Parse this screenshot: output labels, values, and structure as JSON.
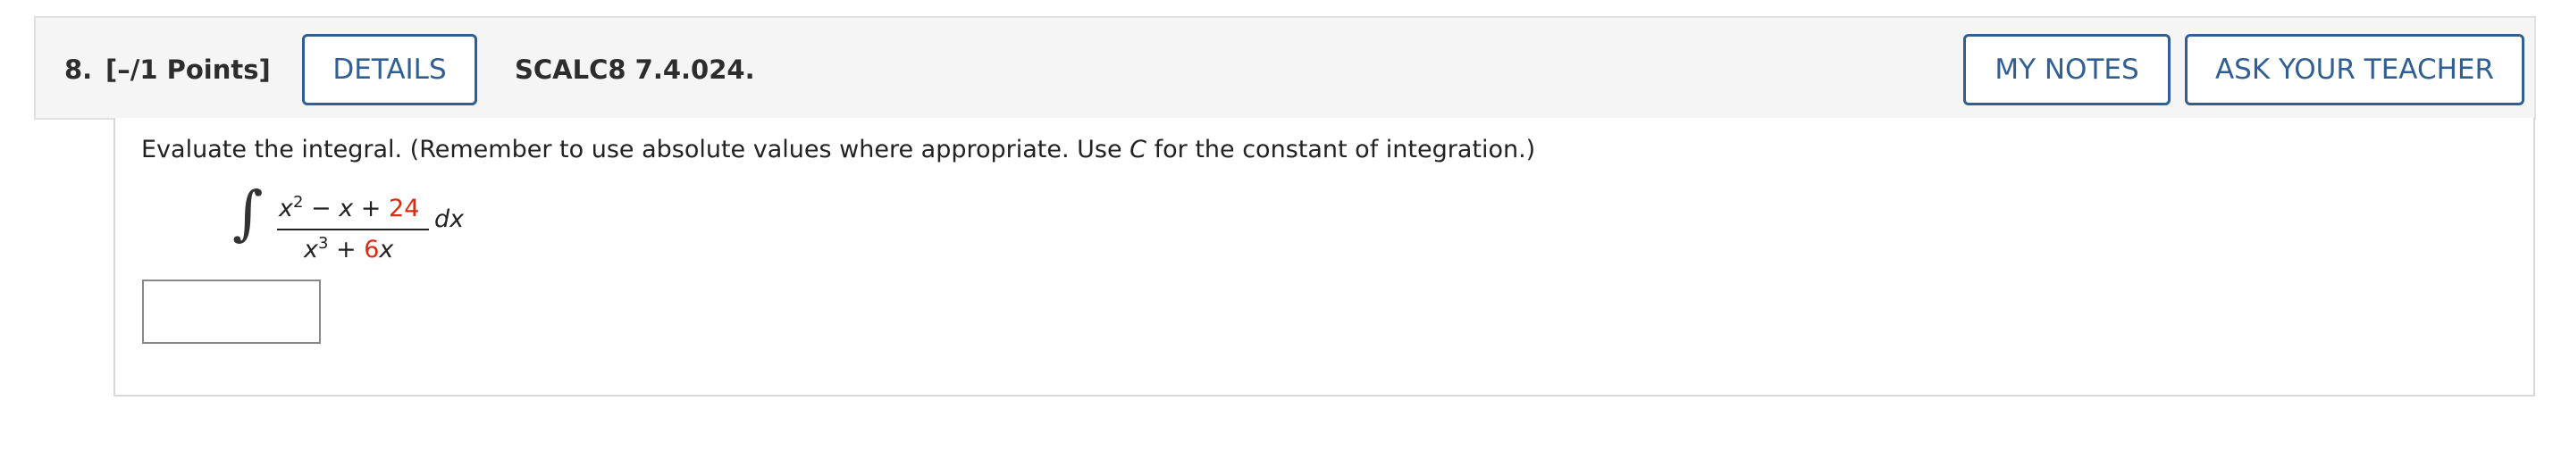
{
  "question": {
    "number": "8.",
    "points": "[–/1 Points]",
    "details_label": "DETAILS",
    "code": "SCALC8 7.4.024.",
    "my_notes_label": "MY NOTES",
    "ask_teacher_label": "ASK YOUR TEACHER"
  },
  "problem": {
    "prompt_before_c": "Evaluate the integral. (Remember to use absolute values where appropriate. Use ",
    "prompt_c": "C",
    "prompt_after_c": " for the constant of integration.)",
    "integral_sign": "∫",
    "numerator": {
      "x": "x",
      "x_exp": "2",
      "middle": " − ",
      "x2": "x",
      "plus": " + ",
      "const": "24"
    },
    "denominator": {
      "x": "x",
      "x_exp": "3",
      "plus": " + ",
      "coef": "6",
      "x2": "x"
    },
    "differential": "dx",
    "answer_value": ""
  },
  "colors": {
    "accent": "#2f5f94",
    "highlight": "#dd2a12"
  }
}
